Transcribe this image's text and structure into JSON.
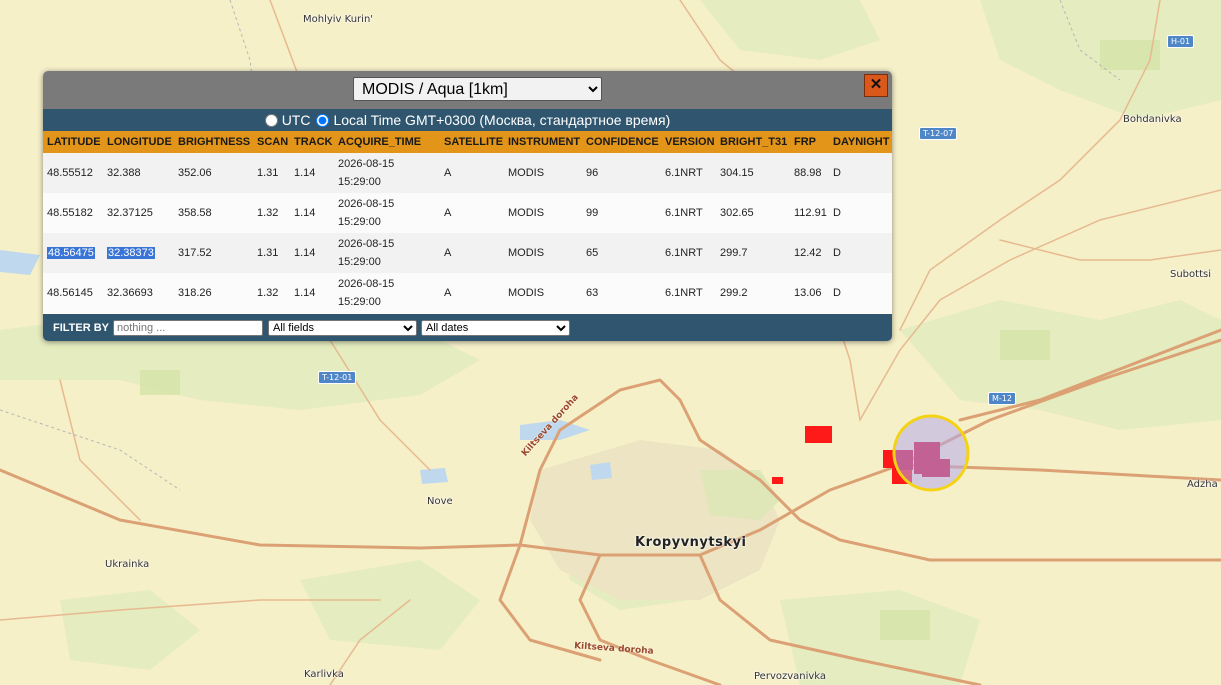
{
  "map": {
    "colors": {
      "land": "#f6f0c9",
      "road": "#dba174",
      "fire": "#ff1a1a",
      "highlight_ring": "#f4d312"
    },
    "places": {
      "mohlyiv_kurin": "Mohlyiv Kurin'",
      "bohdanivka": "Bohdanivka",
      "subottsi": "Subottsi",
      "nove": "Nove",
      "ukrainka": "Ukrainka",
      "kropyvnytskyi": "Kropyvnytskyi",
      "adzha": "Adzha",
      "karlivka": "Karlivka",
      "pervozvanivka": "Pervozvanivka"
    },
    "road_labels": {
      "kiltseva_1": "Kiltseva doroha",
      "kiltseva_2": "Kiltseva doroha"
    },
    "shields": {
      "h01": "H-01",
      "t1207": "T-12-07",
      "t1201": "T-12-01",
      "m12": "M-12"
    }
  },
  "panel": {
    "satellite_select": {
      "value": "MODIS / Aqua [1km]",
      "options": [
        "MODIS / Aqua [1km]"
      ]
    },
    "close_label": "✕",
    "timezone": {
      "utc_label": "UTC",
      "local_label": "Local Time GMT+0300 (Москва, стандартное время)",
      "selected": "local"
    },
    "table": {
      "columns": [
        "LATITUDE",
        "LONGITUDE",
        "BRIGHTNESS",
        "SCAN",
        "TRACK",
        "ACQUIRE_TIME",
        "SATELLITE",
        "INSTRUMENT",
        "CONFIDENCE",
        "VERSION",
        "BRIGHT_T31",
        "FRP",
        "DAYNIGHT"
      ],
      "rows": [
        {
          "latitude": "48.55512",
          "longitude": "32.388",
          "brightness": "352.06",
          "scan": "1.31",
          "track": "1.14",
          "date": "2026-08-15",
          "time": "15:29:00",
          "satellite": "A",
          "instrument": "MODIS",
          "confidence": "96",
          "version": "6.1NRT",
          "bright_t31": "304.15",
          "frp": "88.98",
          "daynight": "D"
        },
        {
          "latitude": "48.55182",
          "longitude": "32.37125",
          "brightness": "358.58",
          "scan": "1.32",
          "track": "1.14",
          "date": "2026-08-15",
          "time": "15:29:00",
          "satellite": "A",
          "instrument": "MODIS",
          "confidence": "99",
          "version": "6.1NRT",
          "bright_t31": "302.65",
          "frp": "112.91",
          "daynight": "D"
        },
        {
          "latitude": "48.56475",
          "longitude": "32.38373",
          "brightness": "317.52",
          "scan": "1.31",
          "track": "1.14",
          "date": "2026-08-15",
          "time": "15:29:00",
          "satellite": "A",
          "instrument": "MODIS",
          "confidence": "65",
          "version": "6.1NRT",
          "bright_t31": "299.7",
          "frp": "12.42",
          "daynight": "D"
        },
        {
          "latitude": "48.56145",
          "longitude": "32.36693",
          "brightness": "318.26",
          "scan": "1.32",
          "track": "1.14",
          "date": "2026-08-15",
          "time": "15:29:00",
          "satellite": "A",
          "instrument": "MODIS",
          "confidence": "63",
          "version": "6.1NRT",
          "bright_t31": "299.2",
          "frp": "13.06",
          "daynight": "D"
        }
      ]
    },
    "filter": {
      "label": "FILTER BY",
      "placeholder": "nothing ...",
      "field_value": "All fields",
      "field_options": [
        "All fields"
      ],
      "date_value": "All dates",
      "date_options": [
        "All dates"
      ]
    }
  }
}
